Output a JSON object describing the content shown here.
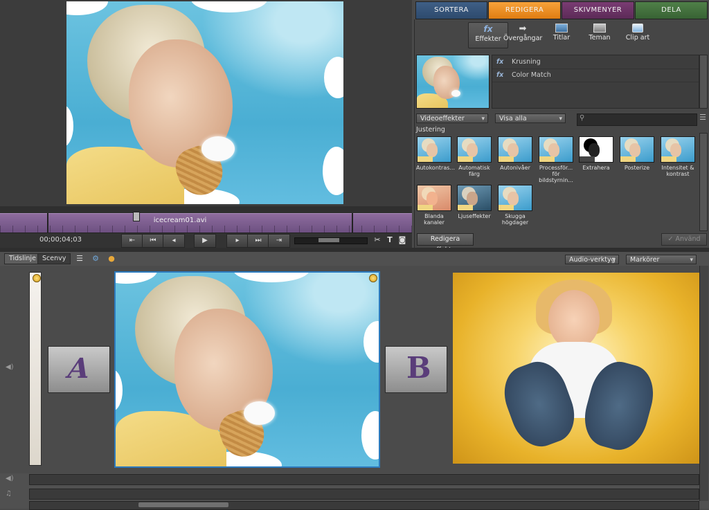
{
  "tabs": {
    "sortera": "SORTERA",
    "redigera": "REDIGERA",
    "skivmenyer": "SKIVMENYER",
    "dela": "DELA"
  },
  "subtools": {
    "effekter": "Effekter",
    "overgangar": "Övergångar",
    "titlar": "Titlar",
    "teman": "Teman",
    "clipart": "Clip art"
  },
  "applied_effects": [
    "Krusning",
    "Color Match"
  ],
  "filters": {
    "category": "Videoeffekter",
    "show": "Visa alla",
    "search_placeholder": ""
  },
  "gallery": {
    "category_label": "Justering",
    "effects": [
      "Autokontras...",
      "Automatisk färg",
      "Autonivåer",
      "Processför... för bildstyrnin...",
      "Extrahera",
      "Posterize",
      "Intensitet & kontrast",
      "Blanda kanaler",
      "Ljuseffekter",
      "Skugga högdager"
    ]
  },
  "buttons": {
    "redigera_effekter": "Redigera effekter",
    "anvand": "Använd"
  },
  "monitor": {
    "clip_name": "icecream01.avi",
    "timecode": "00;00;04;03"
  },
  "view_tabs": {
    "tidslinje": "Tidslinje",
    "scenvy": "Scenvy"
  },
  "bottom_dropdowns": {
    "audio": "Audio-verktyg",
    "markers": "Markörer"
  },
  "colors": {
    "accent_orange": "#e88a1f",
    "clip_border_blue": "#2c7bbf",
    "timeline_purple": "#7a5b8d"
  }
}
